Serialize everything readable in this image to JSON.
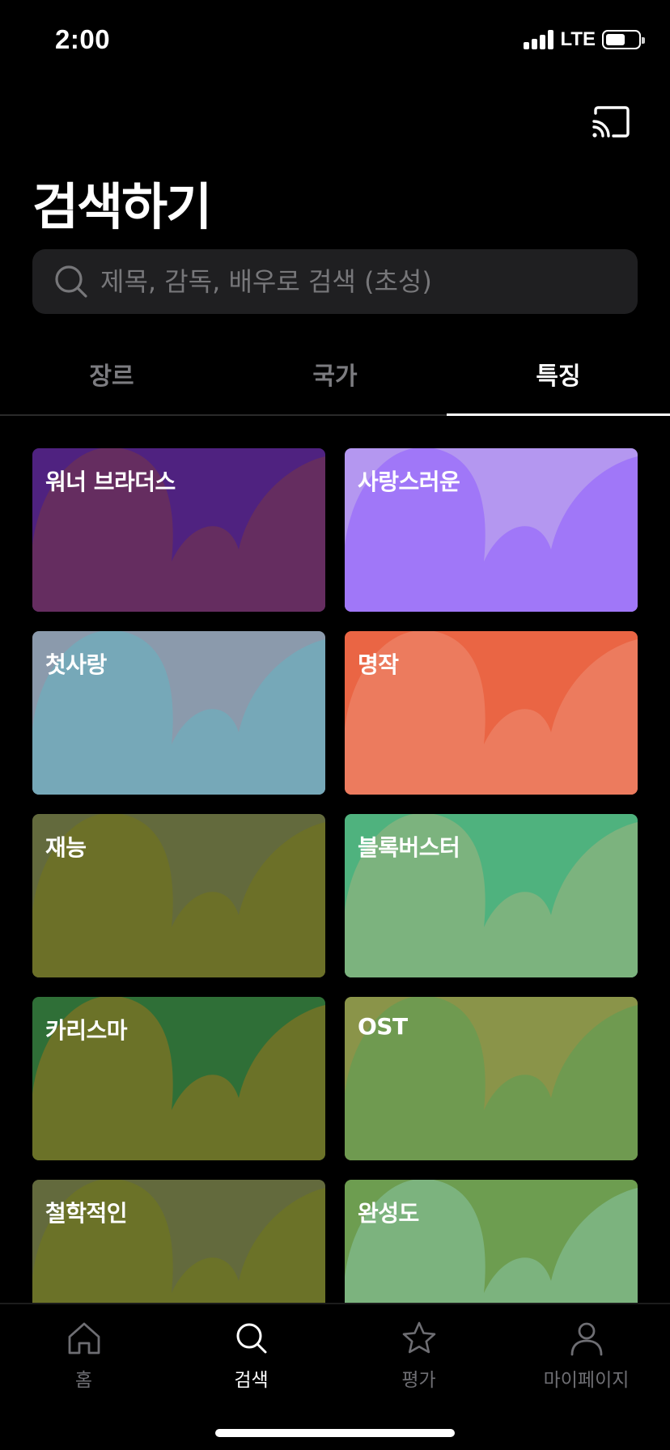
{
  "status_bar": {
    "time": "2:00",
    "network": "LTE"
  },
  "page": {
    "title": "검색하기"
  },
  "search": {
    "placeholder": "제목, 감독, 배우로 검색 (초성)"
  },
  "tabs": [
    {
      "label": "장르",
      "active": false
    },
    {
      "label": "국가",
      "active": false
    },
    {
      "label": "특징",
      "active": true
    }
  ],
  "cards": [
    {
      "label": "워너 브라더스",
      "base": "#652d60",
      "accent": "#4f2280"
    },
    {
      "label": "사랑스러운",
      "base": "#a077f8",
      "accent": "#b497f0"
    },
    {
      "label": "첫사랑",
      "base": "#76a8b8",
      "accent": "#8b9aac"
    },
    {
      "label": "명작",
      "base": "#ec7b5e",
      "accent": "#ea6544"
    },
    {
      "label": "재능",
      "base": "#6c7028",
      "accent": "#636a3d"
    },
    {
      "label": "블록버스터",
      "base": "#7cb37e",
      "accent": "#4fb27e"
    },
    {
      "label": "카리스마",
      "base": "#6b7228",
      "accent": "#2f6f37"
    },
    {
      "label": "OST",
      "base": "#6f9a50",
      "accent": "#8a9449"
    },
    {
      "label": "철학적인",
      "base": "#6b7228",
      "accent": "#636a3d"
    },
    {
      "label": "완성도",
      "base": "#7cb37e",
      "accent": "#6d9d50"
    }
  ],
  "nav": {
    "items": [
      {
        "label": "홈",
        "icon": "home-icon",
        "active": false
      },
      {
        "label": "검색",
        "icon": "search-icon",
        "active": true
      },
      {
        "label": "평가",
        "icon": "star-icon",
        "active": false
      },
      {
        "label": "마이페이지",
        "icon": "profile-icon",
        "active": false
      }
    ]
  }
}
